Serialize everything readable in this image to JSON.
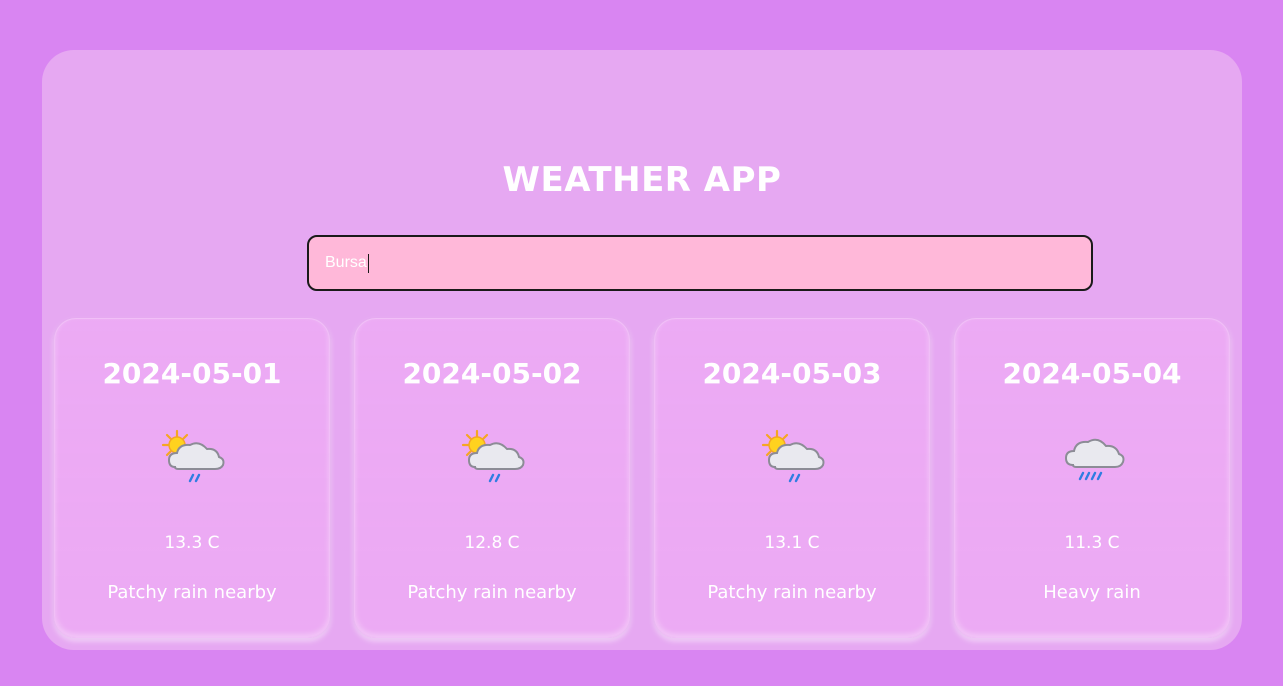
{
  "app": {
    "title": "WEATHER APP"
  },
  "search": {
    "value": "Bursa"
  },
  "forecast": [
    {
      "date": "2024-05-01",
      "icon": "patchy-rain-icon",
      "temp": "13.3 C",
      "condition": "Patchy rain nearby"
    },
    {
      "date": "2024-05-02",
      "icon": "patchy-rain-icon",
      "temp": "12.8 C",
      "condition": "Patchy rain nearby"
    },
    {
      "date": "2024-05-03",
      "icon": "patchy-rain-icon",
      "temp": "13.1 C",
      "condition": "Patchy rain nearby"
    },
    {
      "date": "2024-05-04",
      "icon": "heavy-rain-icon",
      "temp": "11.3 C",
      "condition": "Heavy rain"
    }
  ],
  "colors": {
    "background": "#d985f2",
    "panel": "#e6a8f2",
    "search_fill": "#ffb8d9",
    "text": "#ffffff"
  }
}
